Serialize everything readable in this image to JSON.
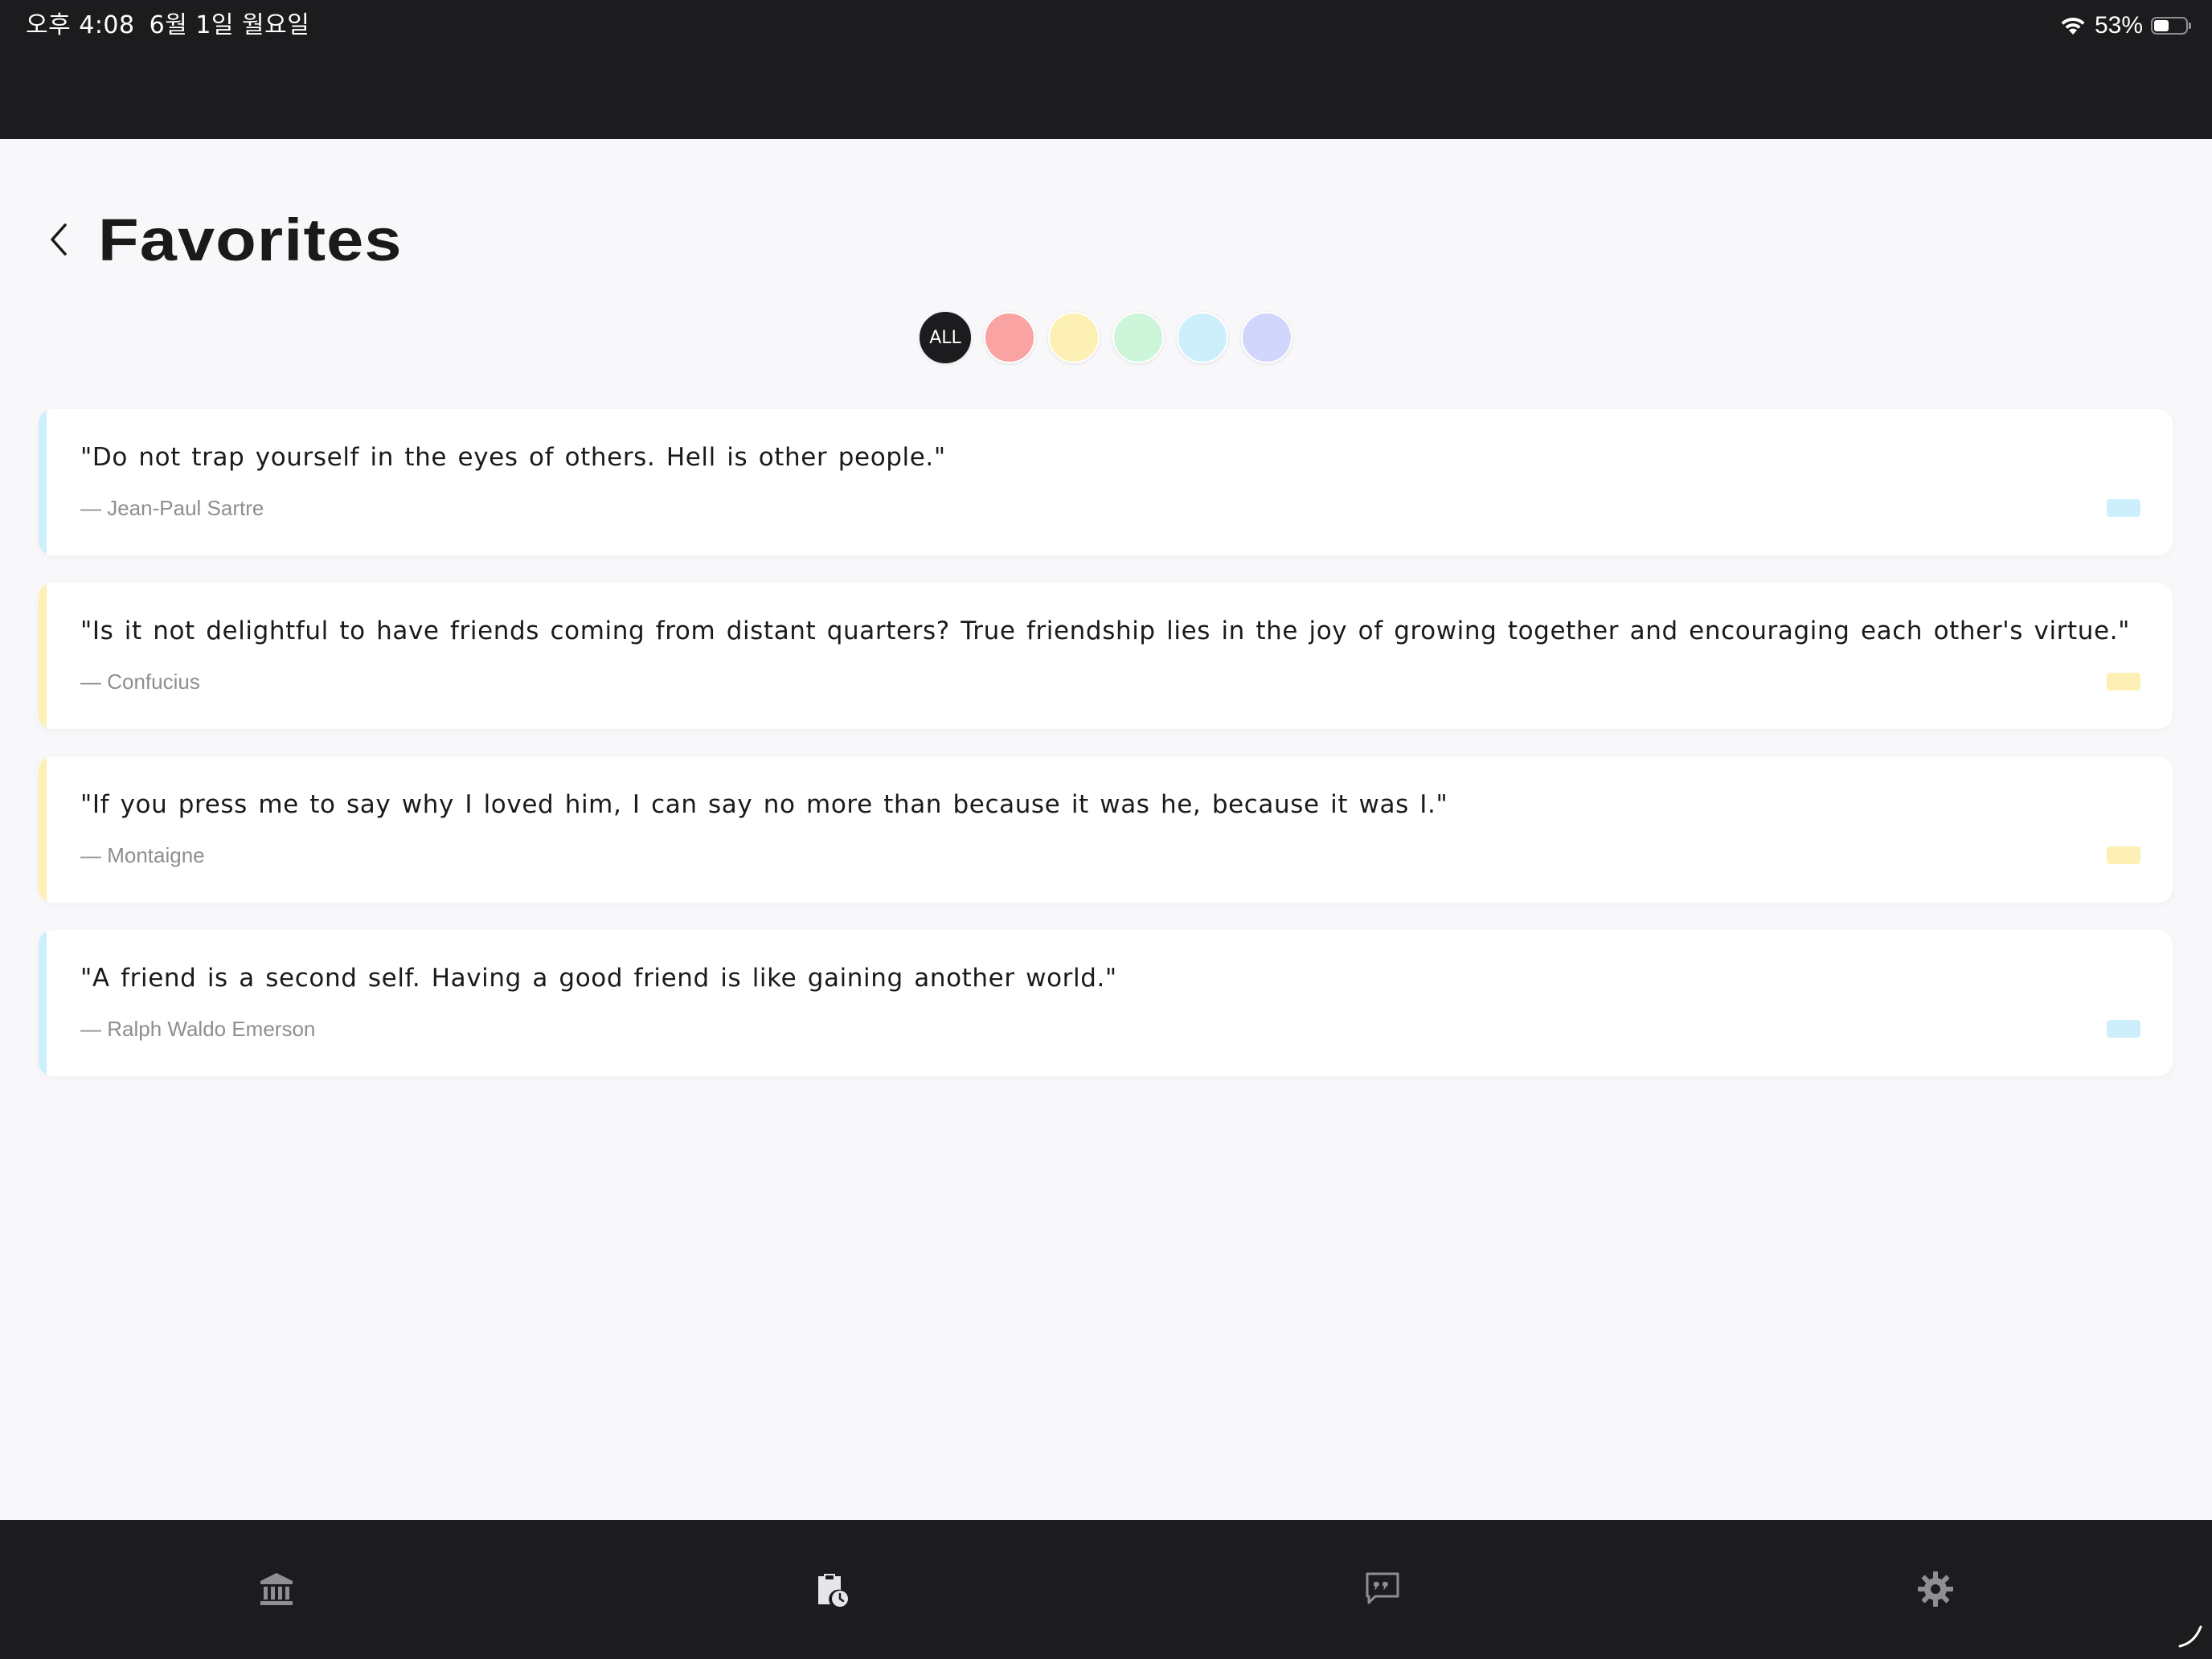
{
  "status_bar": {
    "time": "오후 4:08",
    "date": "6월 1일 월요일",
    "battery": "53%",
    "battery_level": 0.53,
    "icons": [
      "wifi-icon",
      "battery-icon"
    ]
  },
  "header": {
    "back_icon": "chevron-left-icon",
    "title": "Favorites"
  },
  "filters": [
    {
      "id": "all",
      "label": "ALL",
      "color": "#1c1c1e",
      "selected": true
    },
    {
      "id": "red",
      "label": "",
      "color": "#f9a3a3",
      "selected": false
    },
    {
      "id": "yellow",
      "label": "",
      "color": "#fcf0b4",
      "selected": false
    },
    {
      "id": "green",
      "label": "",
      "color": "#cdf5da",
      "selected": false
    },
    {
      "id": "blue",
      "label": "",
      "color": "#cdeffb",
      "selected": false
    },
    {
      "id": "purple",
      "label": "",
      "color": "#d1d7fc",
      "selected": false
    }
  ],
  "quotes": [
    {
      "text": "\"Do not trap yourself in the eyes of others. Hell is other people.\"",
      "author": "— Jean-Paul Sartre",
      "color": "#cdeffb"
    },
    {
      "text": "\"Is it not delightful to have friends coming from distant quarters? True friendship lies in the joy of growing together and encouraging each other's virtue.\"",
      "author": "— Confucius",
      "color": "#fcf0b4"
    },
    {
      "text": "\"If you press me to say why I loved him, I can say no more than because it was he, because it was I.\"",
      "author": "— Montaigne",
      "color": "#fcf0b4"
    },
    {
      "text": "\"A friend is a second self. Having a good friend is like gaining another world.\"",
      "author": "— Ralph Waldo Emerson",
      "color": "#cdeffb"
    }
  ],
  "tab_bar": {
    "items": [
      {
        "icon": "library-icon",
        "active": false
      },
      {
        "icon": "clipboard-clock-icon",
        "active": true
      },
      {
        "icon": "quote-bubble-icon",
        "active": false
      },
      {
        "icon": "gear-icon",
        "active": false
      }
    ]
  },
  "colors": {
    "background": "#f8f8fa",
    "bar": "#1c1c1e",
    "text": "#1a1a1a",
    "muted": "#8e8e93"
  }
}
